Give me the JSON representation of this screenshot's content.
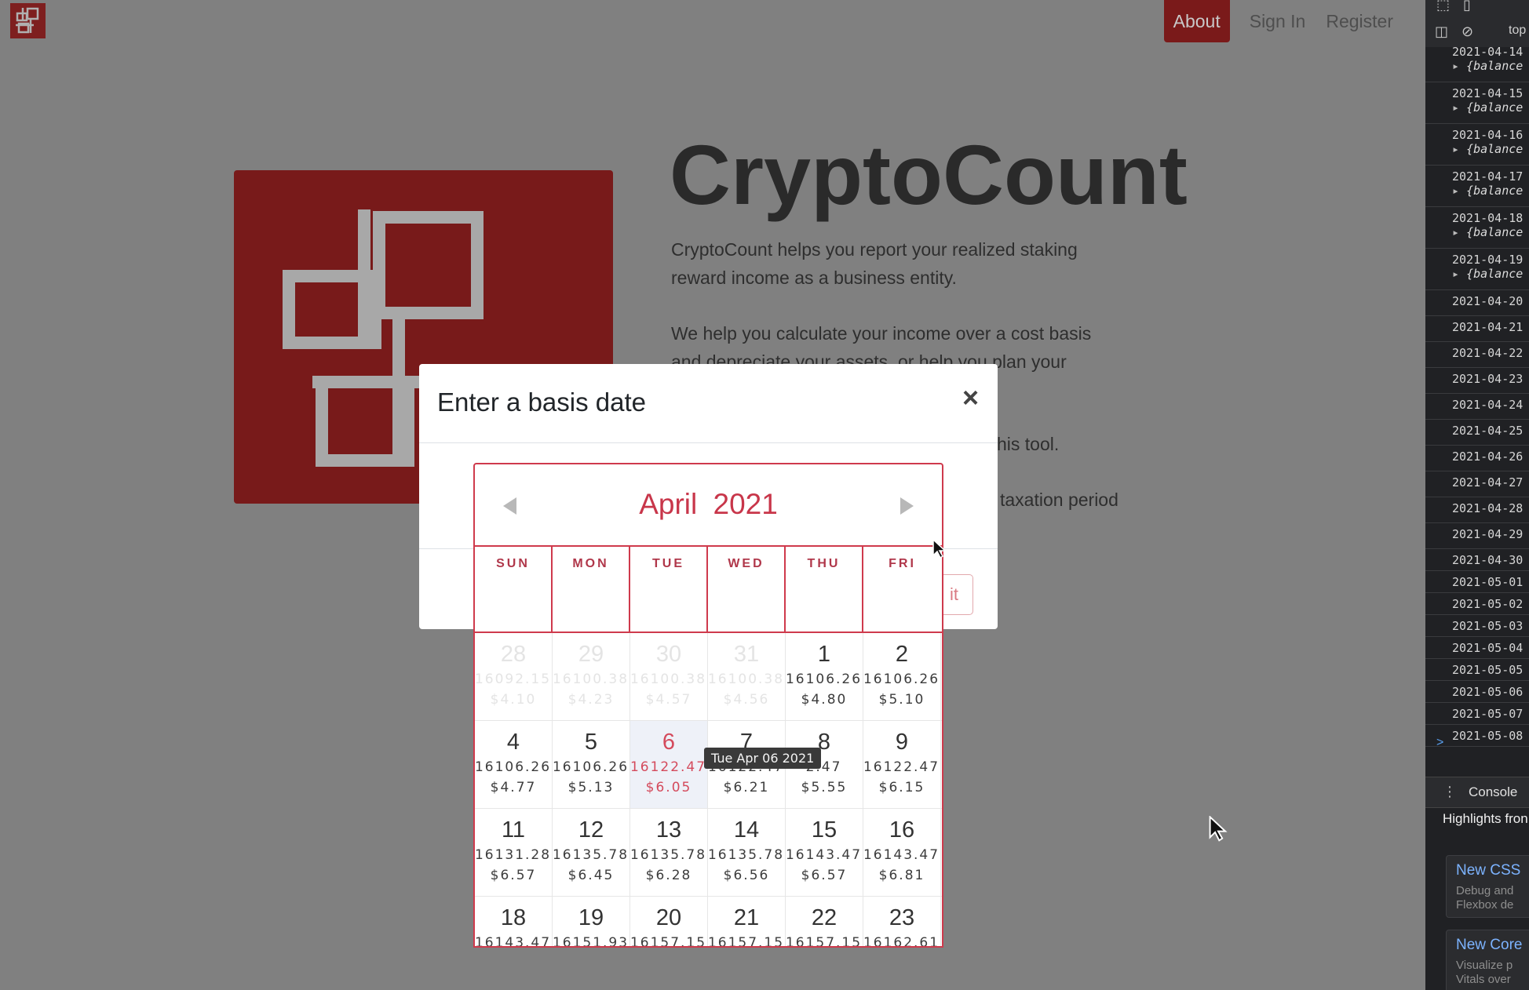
{
  "nav": {
    "about": "About",
    "sign_in": "Sign In",
    "register": "Register"
  },
  "hero": {
    "title": "CryptoCount",
    "p1_line1": "CryptoCount helps you report your realized staking",
    "p1_line2": "reward income as a business entity.",
    "p2_line1": "We help you calculate your income over a cost basis",
    "p2_line2": "and depreciate your assets, or help you plan your",
    "p3_fragment": "his tool.",
    "p4_fragment": "taxation period"
  },
  "modal": {
    "title": "Enter a basis date",
    "close": "×",
    "submit": "it"
  },
  "calendar": {
    "month": "April",
    "year": "2021",
    "weekdays": [
      "SUN",
      "MON",
      "TUE",
      "WED",
      "THU",
      "FRI"
    ],
    "weeks": [
      [
        {
          "day": "28",
          "balance": "16092.15",
          "usd": "$4.10",
          "muted": true
        },
        {
          "day": "29",
          "balance": "16100.38",
          "usd": "$4.23",
          "muted": true
        },
        {
          "day": "30",
          "balance": "16100.38",
          "usd": "$4.57",
          "muted": true
        },
        {
          "day": "31",
          "balance": "16100.38",
          "usd": "$4.56",
          "muted": true
        },
        {
          "day": "1",
          "balance": "16106.26",
          "usd": "$4.80"
        },
        {
          "day": "2",
          "balance": "16106.26",
          "usd": "$5.10"
        }
      ],
      [
        {
          "day": "4",
          "balance": "16106.26",
          "usd": "$4.77"
        },
        {
          "day": "5",
          "balance": "16106.26",
          "usd": "$5.13"
        },
        {
          "day": "6",
          "balance": "16122.47",
          "usd": "$6.05",
          "selected": true
        },
        {
          "day": "7",
          "balance": "16122.47",
          "usd": "$6.21"
        },
        {
          "day": "8",
          "balance": "2.47",
          "usd": "$5.55"
        },
        {
          "day": "9",
          "balance": "16122.47",
          "usd": "$6.15"
        }
      ],
      [
        {
          "day": "11",
          "balance": "16131.28",
          "usd": "$6.57"
        },
        {
          "day": "12",
          "balance": "16135.78",
          "usd": "$6.45"
        },
        {
          "day": "13",
          "balance": "16135.78",
          "usd": "$6.28"
        },
        {
          "day": "14",
          "balance": "16135.78",
          "usd": "$6.56"
        },
        {
          "day": "15",
          "balance": "16143.47",
          "usd": "$6.57"
        },
        {
          "day": "16",
          "balance": "16143.47",
          "usd": "$6.81"
        }
      ],
      [
        {
          "day": "18",
          "balance": "16143.47",
          "usd": ""
        },
        {
          "day": "19",
          "balance": "16151.93",
          "usd": ""
        },
        {
          "day": "20",
          "balance": "16157.15",
          "usd": ""
        },
        {
          "day": "21",
          "balance": "16157.15",
          "usd": ""
        },
        {
          "day": "22",
          "balance": "16157.15",
          "usd": ""
        },
        {
          "day": "23",
          "balance": "16162.61",
          "usd": ""
        }
      ]
    ],
    "tooltip": "Tue Apr 06 2021",
    "accent_color": "#cf3a4c"
  },
  "devtools": {
    "frame": "top",
    "entries": [
      {
        "date": "2021-04-14",
        "obj": "{balance"
      },
      {
        "date": "2021-04-15",
        "obj": "{balance"
      },
      {
        "date": "2021-04-16",
        "obj": "{balance"
      },
      {
        "date": "2021-04-17",
        "obj": "{balance"
      },
      {
        "date": "2021-04-18",
        "obj": "{balance"
      },
      {
        "date": "2021-04-19",
        "obj": "{balance"
      },
      {
        "date": "2021-04-20"
      },
      {
        "date": "2021-04-21"
      },
      {
        "date": "2021-04-22"
      },
      {
        "date": "2021-04-23"
      },
      {
        "date": "2021-04-24"
      },
      {
        "date": "2021-04-25"
      },
      {
        "date": "2021-04-26"
      },
      {
        "date": "2021-04-27"
      },
      {
        "date": "2021-04-28"
      },
      {
        "date": "2021-04-29"
      },
      {
        "date": "2021-04-30"
      },
      {
        "date": "2021-05-01"
      },
      {
        "date": "2021-05-02"
      },
      {
        "date": "2021-05-03"
      },
      {
        "date": "2021-05-04"
      },
      {
        "date": "2021-05-05"
      },
      {
        "date": "2021-05-06"
      },
      {
        "date": "2021-05-07"
      },
      {
        "date": "2021-05-08"
      }
    ],
    "prompt": ">",
    "console_tab": "Console",
    "highlights": "Highlights fron",
    "cards": [
      {
        "title": "New CSS",
        "desc1": "Debug and",
        "desc2": "Flexbox de"
      },
      {
        "title": "New Core",
        "desc1": "Visualize p",
        "desc2": "Vitals over"
      }
    ]
  }
}
